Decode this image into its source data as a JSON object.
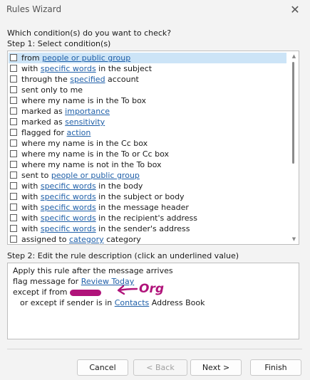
{
  "window": {
    "title": "Rules Wizard"
  },
  "question": "Which condition(s) do you want to check?",
  "step1_label": "Step 1: Select condition(s)",
  "conditions": [
    {
      "selected": true,
      "parts": [
        {
          "t": "from "
        },
        {
          "t": "people or public group",
          "link": true
        }
      ]
    },
    {
      "parts": [
        {
          "t": "with "
        },
        {
          "t": "specific words",
          "link": true
        },
        {
          "t": " in the subject"
        }
      ]
    },
    {
      "parts": [
        {
          "t": "through the "
        },
        {
          "t": "specified",
          "link": true
        },
        {
          "t": " account"
        }
      ]
    },
    {
      "parts": [
        {
          "t": "sent only to me"
        }
      ]
    },
    {
      "parts": [
        {
          "t": "where my name is in the To box"
        }
      ]
    },
    {
      "parts": [
        {
          "t": "marked as "
        },
        {
          "t": "importance",
          "link": true
        }
      ]
    },
    {
      "parts": [
        {
          "t": "marked as "
        },
        {
          "t": "sensitivity",
          "link": true
        }
      ]
    },
    {
      "parts": [
        {
          "t": "flagged for "
        },
        {
          "t": "action",
          "link": true
        }
      ]
    },
    {
      "parts": [
        {
          "t": "where my name is in the Cc box"
        }
      ]
    },
    {
      "parts": [
        {
          "t": "where my name is in the To or Cc box"
        }
      ]
    },
    {
      "parts": [
        {
          "t": "where my name is not in the To box"
        }
      ]
    },
    {
      "parts": [
        {
          "t": "sent to "
        },
        {
          "t": "people or public group",
          "link": true
        }
      ]
    },
    {
      "parts": [
        {
          "t": "with "
        },
        {
          "t": "specific words",
          "link": true
        },
        {
          "t": " in the body"
        }
      ]
    },
    {
      "parts": [
        {
          "t": "with "
        },
        {
          "t": "specific words",
          "link": true
        },
        {
          "t": " in the subject or body"
        }
      ]
    },
    {
      "parts": [
        {
          "t": "with "
        },
        {
          "t": "specific words",
          "link": true
        },
        {
          "t": " in the message header"
        }
      ]
    },
    {
      "parts": [
        {
          "t": "with "
        },
        {
          "t": "specific words",
          "link": true
        },
        {
          "t": " in the recipient's address"
        }
      ]
    },
    {
      "parts": [
        {
          "t": "with "
        },
        {
          "t": "specific words",
          "link": true
        },
        {
          "t": " in the sender's address"
        }
      ]
    },
    {
      "parts": [
        {
          "t": "assigned to "
        },
        {
          "t": "category",
          "link": true
        },
        {
          "t": " category"
        }
      ]
    }
  ],
  "step2_label": "Step 2: Edit the rule description (click an underlined value)",
  "description": {
    "line1": "Apply this rule after the message arrives",
    "line2_prefix": "flag message for ",
    "line2_link": "Review Today",
    "line3_prefix": "except if from",
    "annotation": "Org",
    "line4_prefix": "or except if sender is in ",
    "line4_link": "Contacts",
    "line4_suffix": " Address Book"
  },
  "buttons": {
    "cancel": "Cancel",
    "back": "< Back",
    "next": "Next >",
    "finish": "Finish"
  },
  "colors": {
    "link": "#1f5fa8",
    "selection": "#cce4f7",
    "redaction": "#b0137a"
  }
}
